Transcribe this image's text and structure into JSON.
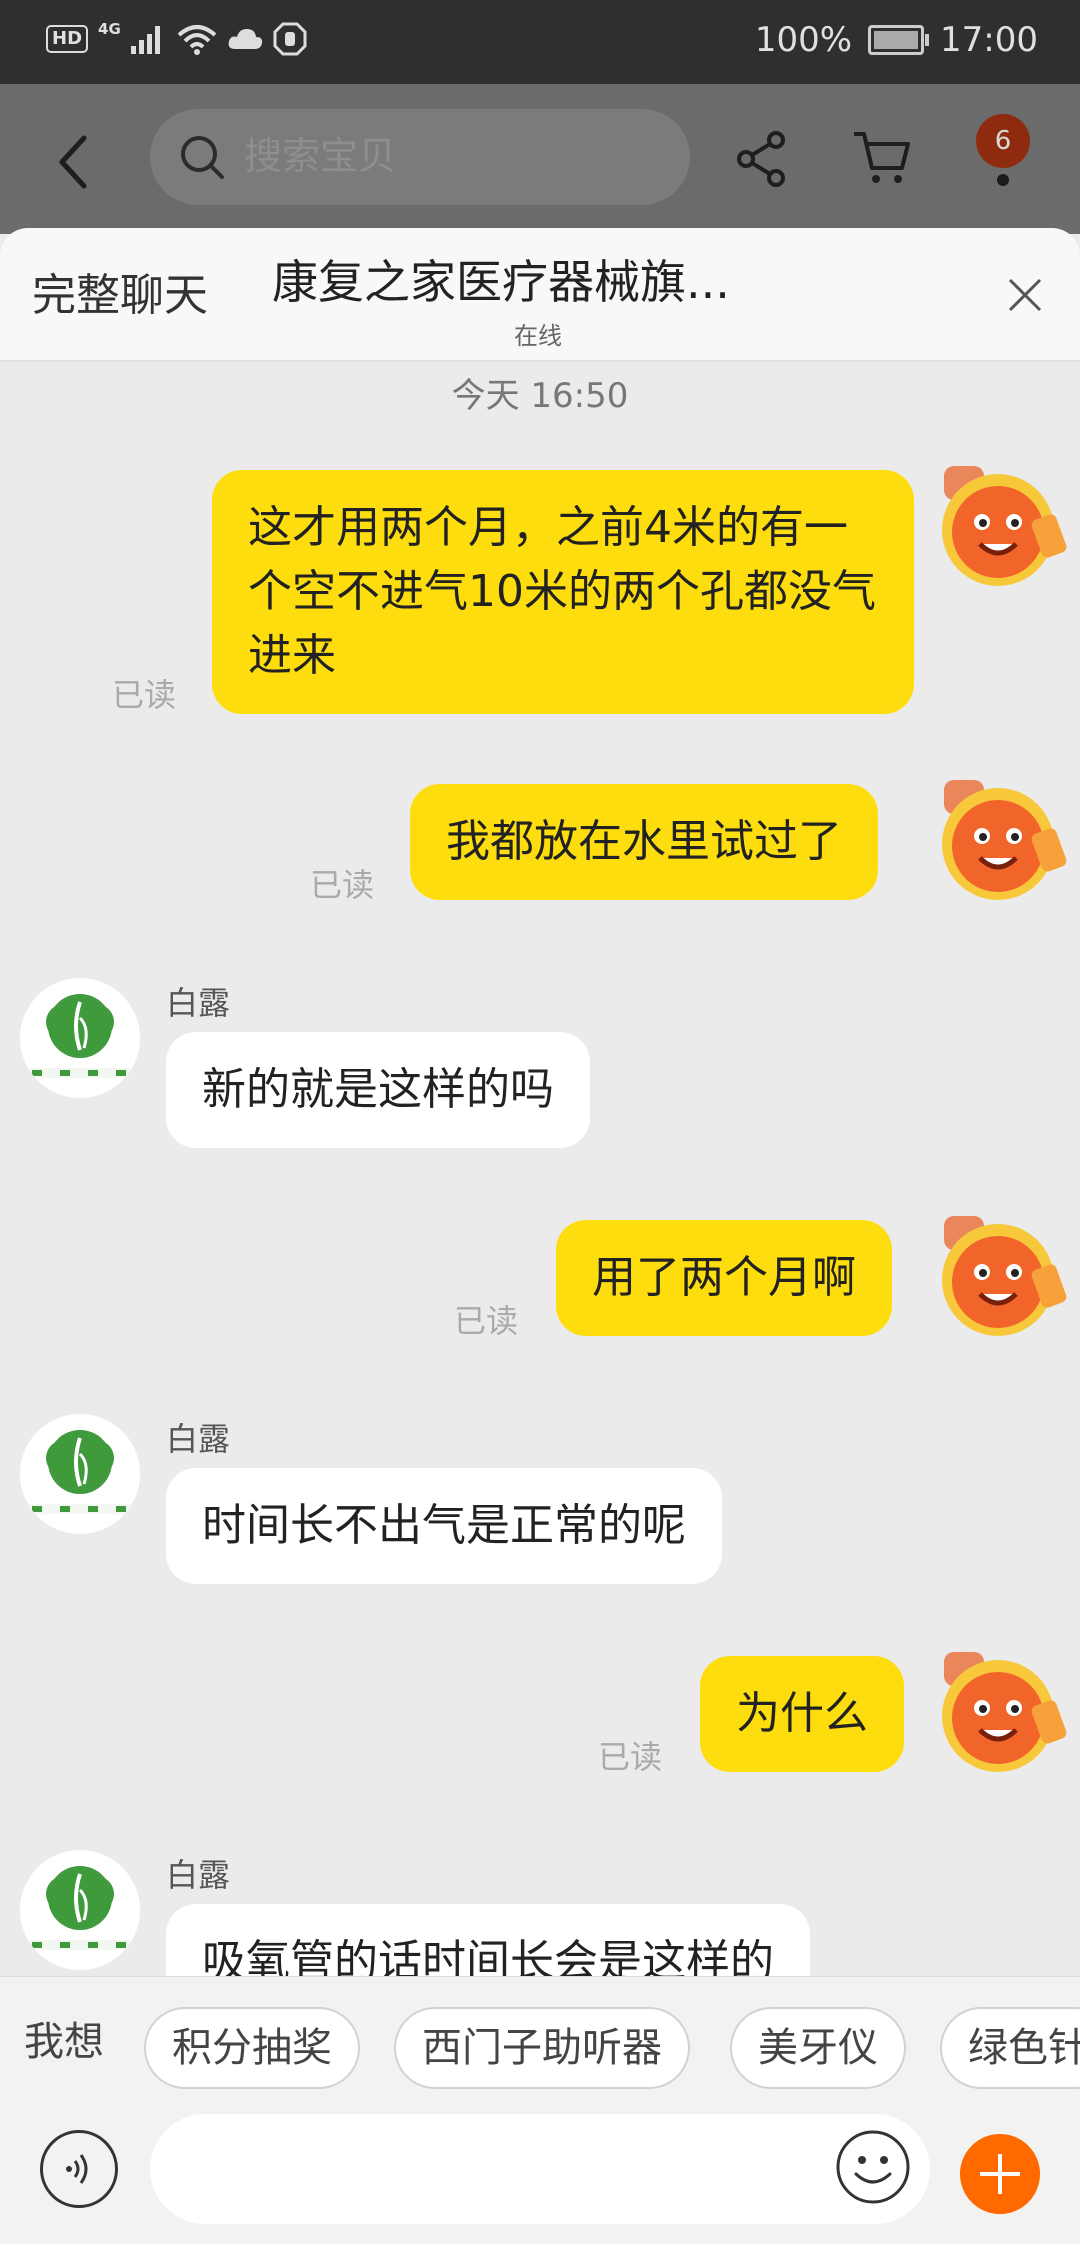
{
  "status_bar": {
    "left_labels": {
      "hd": "HD",
      "network": "4G"
    },
    "battery": "100%",
    "time": "17:00"
  },
  "app_header": {
    "search_placeholder": "搜索宝贝",
    "badge_count": "6"
  },
  "chat_header": {
    "full_chat": "完整聊天",
    "shop_name": "康复之家医疗器械旗...",
    "status": "在线"
  },
  "chat": {
    "timestamp": "今天  16:50",
    "messages": [
      {
        "from": "me",
        "text": "这才用两个月，之前4米的有一个空不进气10米的两个孔都没气进来",
        "read": "已读"
      },
      {
        "from": "me",
        "text": "我都放在水里试过了",
        "read": "已读"
      },
      {
        "from": "shop",
        "sender": "白露",
        "text": "新的就是这样的吗"
      },
      {
        "from": "me",
        "text": "用了两个月啊",
        "read": "已读"
      },
      {
        "from": "shop",
        "sender": "白露",
        "text": "时间长不出气是正常的呢"
      },
      {
        "from": "me",
        "text": "为什么",
        "read": "已读"
      },
      {
        "from": "shop",
        "sender": "白露",
        "text": "吸氧管的话时间长会是这样的"
      }
    ]
  },
  "shop_logo_text": "康复之家",
  "quick_replies": {
    "label": "我想",
    "chips": [
      "积分抽奖",
      "西门子助听器",
      "美牙仪",
      "绿色针"
    ]
  },
  "input": {
    "placeholder": ""
  },
  "colors": {
    "accent_yellow": "#fedd0f",
    "plus_orange": "#ff6a00",
    "logo_green": "#3f9a3c"
  }
}
